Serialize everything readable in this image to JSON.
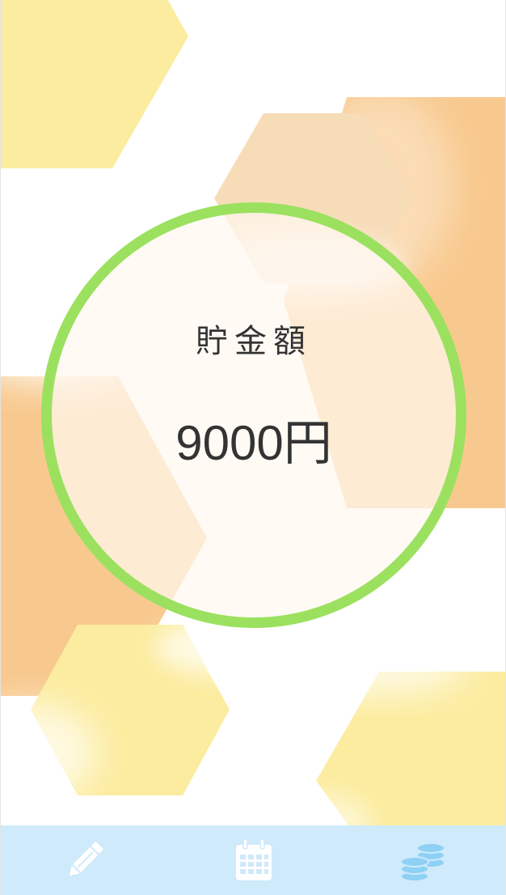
{
  "savings": {
    "label": "貯金額",
    "amount": "9000円"
  },
  "tabbar": {
    "items": [
      {
        "icon": "pencil-icon",
        "active": false
      },
      {
        "icon": "calendar-icon",
        "active": false
      },
      {
        "icon": "coins-icon",
        "active": true
      }
    ]
  },
  "colors": {
    "ring": "#9be15f",
    "tabbar_bg": "#ceeafb",
    "tab_icon": "#ffffff",
    "tab_icon_active": "#8fd0f5",
    "hex_yellow": "#fcec9f",
    "hex_orange": "#f8c98e"
  }
}
